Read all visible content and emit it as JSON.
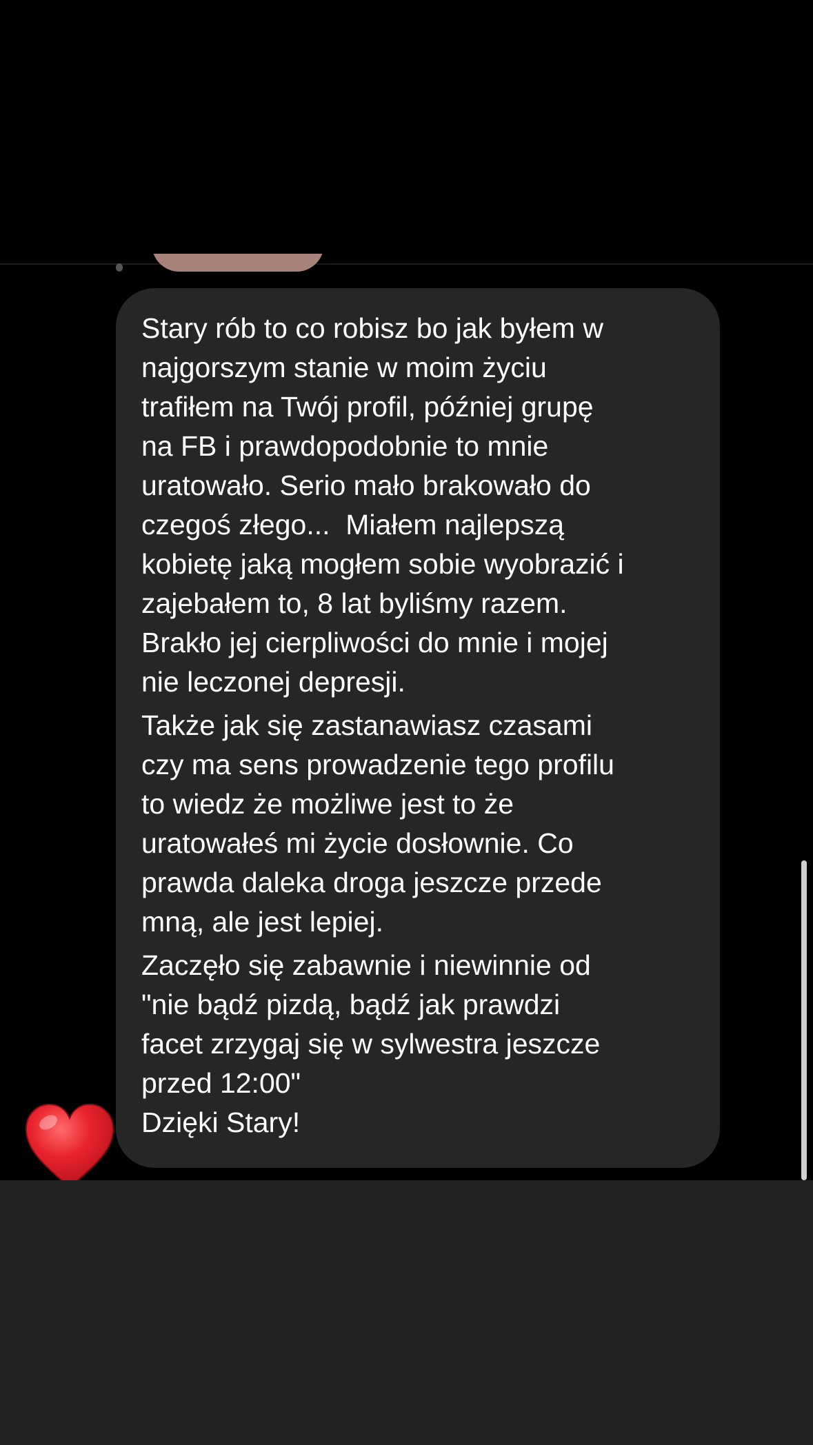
{
  "conversation": {
    "message": {
      "paragraphs": [
        "Stary rób to co robisz bo jak byłem w\nnajgorszym stanie w moim życiu\ntrafiłem na Twój profil, później grupę\nna FB i prawdopodobnie to mnie\nuratowało. Serio mało brakowało do\nczegoś złego...  Miałem najlepszą\nkobietę jaką mogłem sobie wyobrazić i\nzajebałem to, 8 lat byliśmy razem.\nBrakło jej cierpliwości do mnie i mojej\nnie leczonej depresji.",
        "Także jak się zastanawiasz czasami\nczy ma sens prowadzenie tego profilu\nto wiedz że możliwe jest to że\nuratowałeś mi życie dosłownie. Co\nprawda daleka droga jeszcze przede\nmną, ale jest lepiej.",
        "Zaczęło się zabawnie i niewinnie od\n\"nie bądź pizdą, bądź jak prawdzi\nfacet zrzygaj się w sylwestra jeszcze\nprzed 12:00\"\nDzięki Stary!"
      ],
      "reaction": {
        "icon": "heart-icon",
        "color": "#e0242d"
      }
    },
    "previous_message": {
      "color": "#a7827a"
    }
  },
  "colors": {
    "background": "#000000",
    "bubble": "#262626",
    "text": "#ffffff",
    "bottom_panel": "#222222"
  }
}
